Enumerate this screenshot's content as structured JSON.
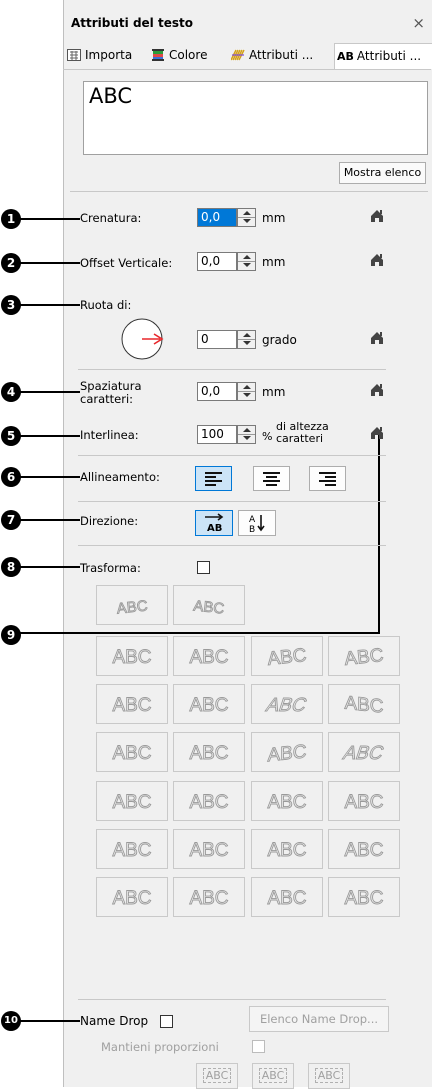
{
  "window": {
    "title": "Attributi del testo",
    "close": "×"
  },
  "tabs": [
    {
      "label": "Importa",
      "icon": "import-icon"
    },
    {
      "label": "Colore",
      "icon": "color-icon"
    },
    {
      "label": "Attributi ...",
      "icon": "stitch-attributes-icon"
    },
    {
      "label": "Attributi ...",
      "icon": "text-attributes-icon",
      "icon_text": "AB"
    }
  ],
  "text_input": {
    "value": "ABC"
  },
  "show_list_button": "Mostra elenco",
  "callouts": [
    "1",
    "2",
    "3",
    "4",
    "5",
    "6",
    "7",
    "8",
    "9",
    "10"
  ],
  "kerning": {
    "label": "Crenatura:",
    "value": "0,0",
    "unit": "mm"
  },
  "vertical_offset": {
    "label": "Offset Verticale:",
    "value": "0,0",
    "unit": "mm"
  },
  "rotate": {
    "label": "Ruota di:",
    "value": "0",
    "unit": "grado"
  },
  "char_spacing": {
    "label": "Spaziatura\ncaratteri:",
    "value": "0,0",
    "unit": "mm"
  },
  "line_spacing": {
    "label": "Interlinea:",
    "value": "100",
    "unit_prefix": "%",
    "unit": "di altezza\ncaratteri"
  },
  "alignment": {
    "label": "Allineamento:",
    "options": [
      "left",
      "center",
      "right"
    ],
    "selected": "left"
  },
  "direction": {
    "label": "Direzione:",
    "options": [
      "horizontal",
      "vertical"
    ],
    "selected": "horizontal"
  },
  "transform": {
    "label": "Trasforma:",
    "checked": false
  },
  "shape_text": "ABC",
  "name_drop": {
    "label": "Name Drop",
    "checked": false,
    "list_button": "Elenco Name Drop...",
    "keep_proportions": "Mantieni proporzioni"
  },
  "placement_options": [
    "ABC",
    "ABC",
    "ABC"
  ],
  "colors": {
    "accent": "#0078d7",
    "arrow": "#e8262a",
    "selected_bg": "#cce4f7",
    "disabled": "#a0a0a0"
  }
}
